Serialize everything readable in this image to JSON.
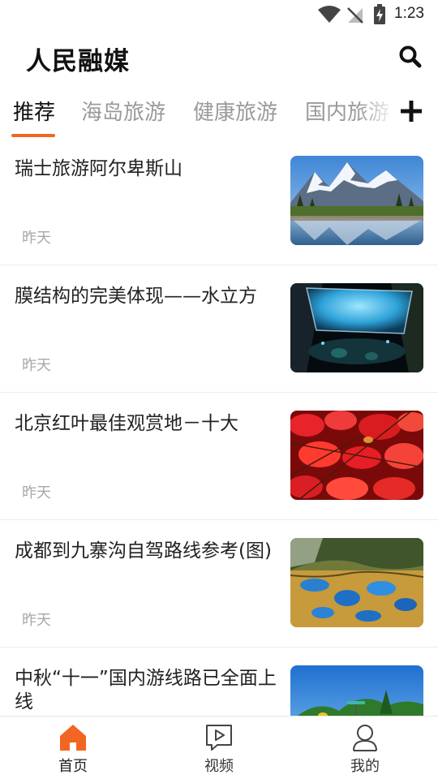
{
  "status_bar": {
    "time": "1:23"
  },
  "header": {
    "title": "人民融媒"
  },
  "tabs": [
    {
      "label": "推荐",
      "active": true
    },
    {
      "label": "海岛旅游",
      "active": false
    },
    {
      "label": "健康旅游",
      "active": false
    },
    {
      "label": "国内旅游",
      "active": false
    }
  ],
  "feed": {
    "items": [
      {
        "title": "瑞士旅游阿尔卑斯山",
        "time": "昨天"
      },
      {
        "title": "膜结构的完美体现——水立方",
        "time": "昨天"
      },
      {
        "title": "北京红叶最佳观赏地－十大",
        "time": "昨天"
      },
      {
        "title": "成都到九寨沟自驾路线参考(图)",
        "time": "昨天"
      },
      {
        "title": "中秋“十一”国内游线路已全面上线",
        "time": ""
      }
    ]
  },
  "bottom_nav": {
    "items": [
      {
        "label": "首页",
        "icon": "home-icon",
        "active": true
      },
      {
        "label": "视频",
        "icon": "video-icon",
        "active": false
      },
      {
        "label": "我的",
        "icon": "user-icon",
        "active": false
      }
    ]
  },
  "colors": {
    "accent": "#f26522",
    "text": "#222222",
    "muted": "#a8a8a8"
  }
}
